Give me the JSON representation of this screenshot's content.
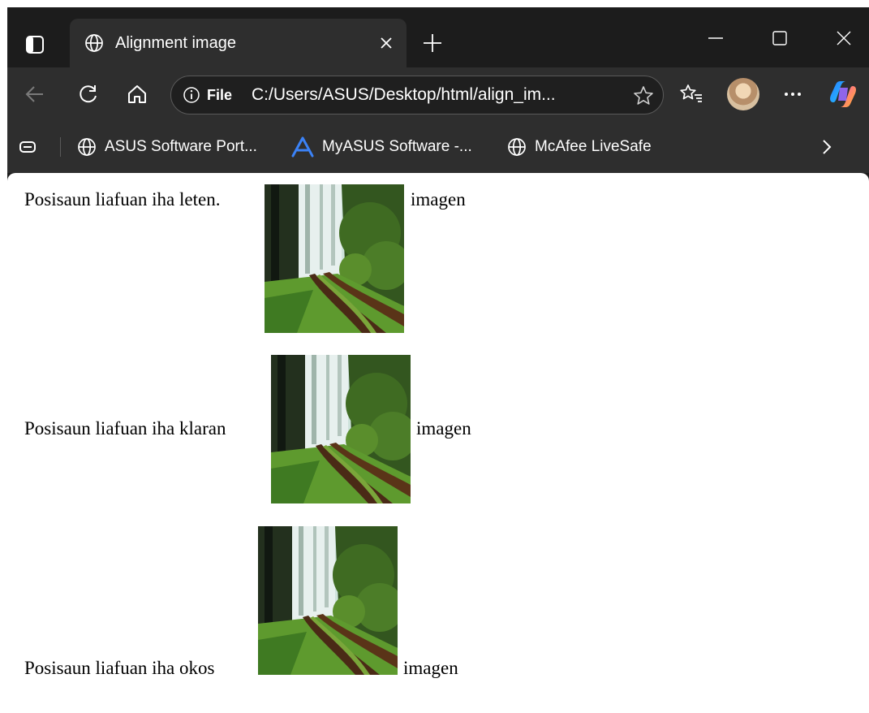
{
  "browser": {
    "tab": {
      "title": "Alignment image"
    },
    "address": {
      "scheme_label": "File",
      "url": "C:/Users/ASUS/Desktop/html/align_im..."
    },
    "bookmarks": [
      {
        "label": "ASUS Software Port..."
      },
      {
        "label": "MyASUS Software -..."
      },
      {
        "label": "McAfee LiveSafe"
      }
    ]
  },
  "page": {
    "rows": [
      {
        "text": "Posisaun liafuan iha leten.",
        "after": "imagen"
      },
      {
        "text": "Posisaun liafuan iha klaran",
        "after": "imagen"
      },
      {
        "text": "Posisaun liafuan iha okos",
        "after": "imagen"
      }
    ]
  },
  "colors": {
    "titlebar": "#1c1c1c",
    "toolbar": "#2e2e2e",
    "page_bg": "#ffffff",
    "myasus_accent": "#3b82f6"
  }
}
